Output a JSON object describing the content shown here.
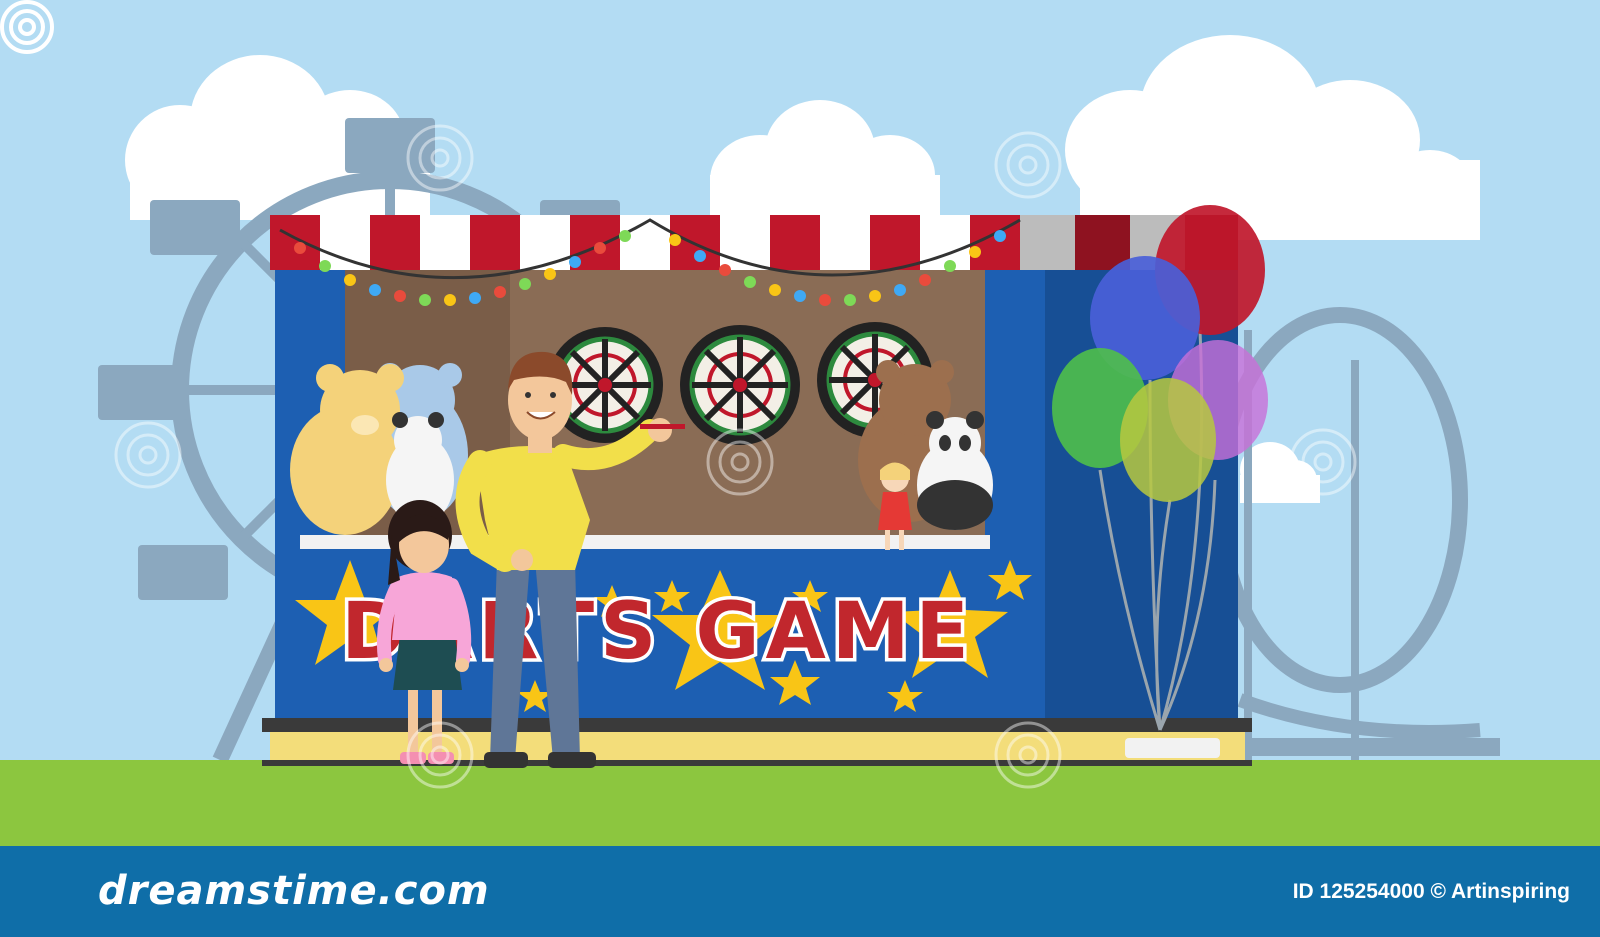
{
  "scene": {
    "booth_sign": "DARTS GAME",
    "colors": {
      "sky": "#b3dcf3",
      "grass": "#8cc63f",
      "booth_blue": "#1d5fb2",
      "awning_red": "#c0172b",
      "sign_red": "#c1272d",
      "star_yellow": "#f9c516"
    }
  },
  "footer": {
    "brand": "dreamstime.com",
    "credit": "ID 125254000 © Artinspiring"
  }
}
